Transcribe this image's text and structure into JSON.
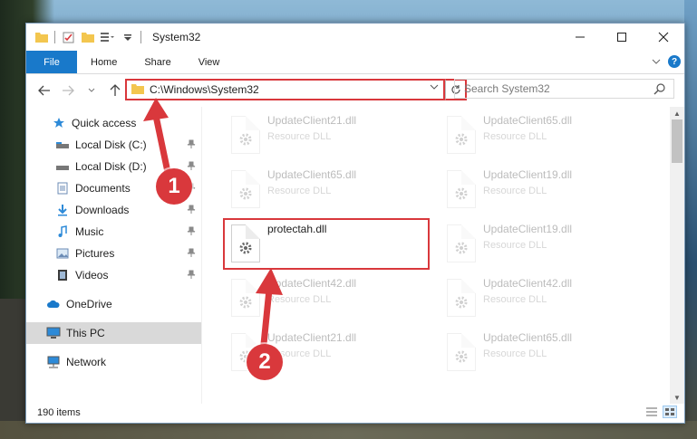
{
  "window": {
    "title": "System32",
    "ribbon_tabs": [
      "File",
      "Home",
      "Share",
      "View"
    ],
    "help_label": "?"
  },
  "navigation": {
    "address_path": "C:\\Windows\\System32",
    "search_placeholder": "Search System32"
  },
  "sidebar": {
    "items": [
      {
        "label": "Quick access",
        "icon": "star-icon"
      },
      {
        "label": "Local Disk (C:)",
        "icon": "drive-icon",
        "pinned": true
      },
      {
        "label": "Local Disk (D:)",
        "icon": "drive-icon",
        "pinned": true
      },
      {
        "label": "Documents",
        "icon": "documents-icon",
        "pinned": true
      },
      {
        "label": "Downloads",
        "icon": "downloads-icon",
        "pinned": true
      },
      {
        "label": "Music",
        "icon": "music-icon",
        "pinned": true
      },
      {
        "label": "Pictures",
        "icon": "pictures-icon",
        "pinned": true
      },
      {
        "label": "Videos",
        "icon": "videos-icon",
        "pinned": true
      },
      {
        "label": "OneDrive",
        "icon": "cloud-icon"
      },
      {
        "label": "This PC",
        "icon": "computer-icon",
        "selected": true
      },
      {
        "label": "Network",
        "icon": "network-icon"
      }
    ]
  },
  "files": [
    {
      "name": "UpdateClient21.dll",
      "type": "Resource DLL"
    },
    {
      "name": "UpdateClient65.dll",
      "type": "Resource DLL"
    },
    {
      "name": "UpdateClient65.dll",
      "type": "Resource DLL"
    },
    {
      "name": "UpdateClient19.dll",
      "type": "Resource DLL"
    },
    {
      "name": "protectah.dll",
      "type": ""
    },
    {
      "name": "UpdateClient19.dll",
      "type": "Resource DLL"
    },
    {
      "name": "UpdateClient42.dll",
      "type": "Resource DLL"
    },
    {
      "name": "UpdateClient42.dll",
      "type": "Resource DLL"
    },
    {
      "name": "UpdateClient21.dll",
      "type": "Resource DLL"
    },
    {
      "name": "UpdateClient65.dll",
      "type": "Resource DLL"
    }
  ],
  "status": {
    "item_count": "190 items"
  },
  "callouts": {
    "one": "1",
    "two": "2"
  },
  "colors": {
    "accent": "#1979ca",
    "highlight_red": "#d9383c"
  }
}
